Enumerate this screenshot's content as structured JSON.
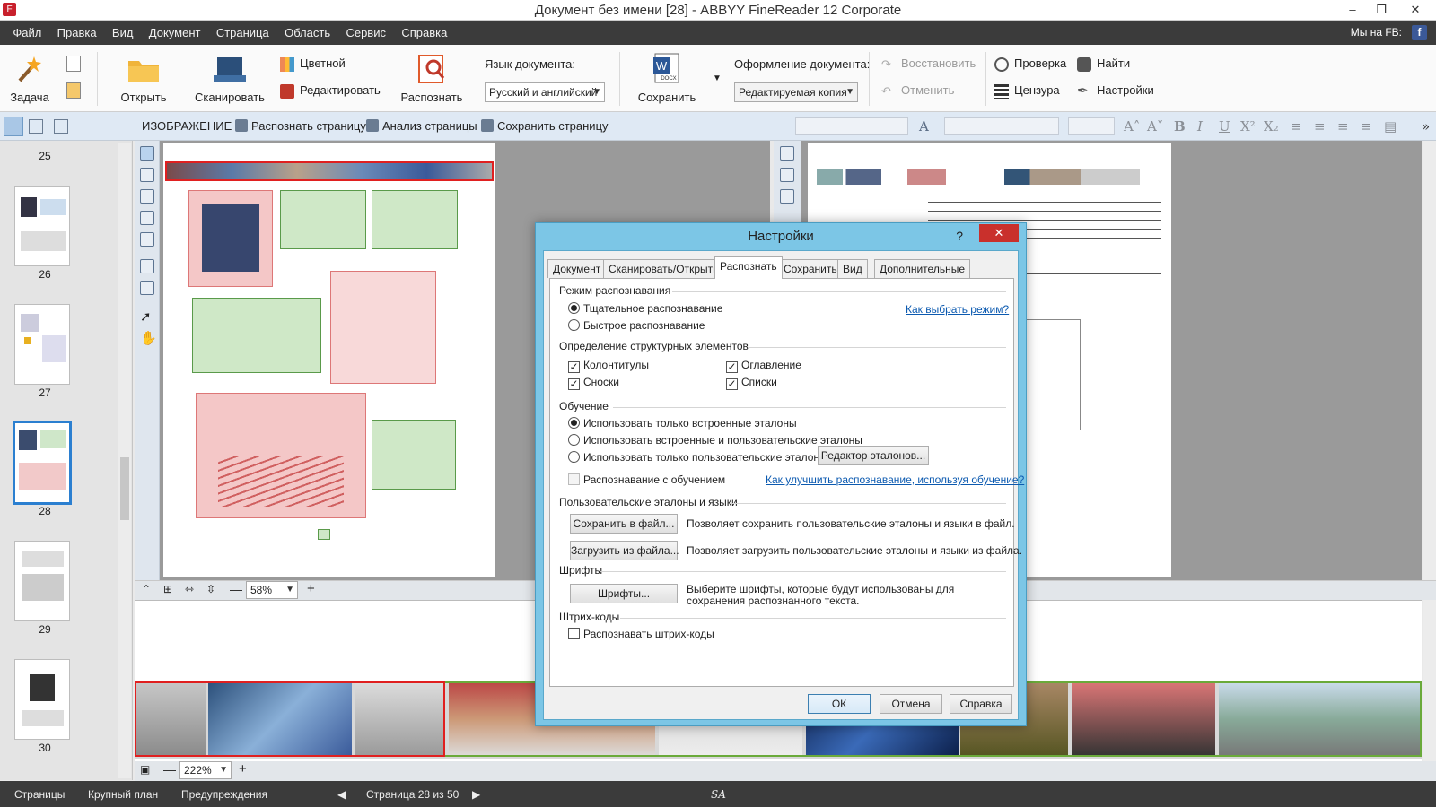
{
  "window": {
    "title": "Документ без имени [28] - ABBYY FineReader 12 Corporate",
    "app_icon": "F"
  },
  "menu": {
    "items": [
      "Файл",
      "Правка",
      "Вид",
      "Документ",
      "Страница",
      "Область",
      "Сервис",
      "Справка"
    ],
    "fb_label": "Мы на FB:",
    "fb_icon": "f"
  },
  "ribbon": {
    "task": "Задача",
    "open": "Открыть",
    "scan": "Сканировать",
    "color": "Цветной",
    "edit": "Редактировать",
    "recognize": "Распознать",
    "lang_label": "Язык документа:",
    "lang_value": "Русский и английский",
    "save": "Сохранить",
    "save_icon_text": "DOCX",
    "format_label": "Оформление документа:",
    "format_value": "Редактируемая копия",
    "restore": "Восстановить",
    "undo": "Отменить",
    "check": "Проверка",
    "find": "Найти",
    "censor": "Цензура",
    "settings": "Настройки"
  },
  "subbar": {
    "image_label": "ИЗОБРАЖЕНИЕ",
    "recognize_page": "Распознать страницу",
    "analyze_page": "Анализ страницы",
    "save_page": "Сохранить страницу"
  },
  "format_toolbar": {
    "bold": "B",
    "italic": "I",
    "underline": "U",
    "superscript": "X²",
    "subscript": "X₂",
    "grow": "A˄",
    "shrink": "A˅"
  },
  "thumbnails": {
    "pages": [
      "25",
      "26",
      "27",
      "28",
      "29",
      "30"
    ],
    "selected": "28"
  },
  "image_view": {
    "zoom": "58%"
  },
  "zoom_view": {
    "zoom": "222%"
  },
  "status": {
    "pages_tab": "Страницы",
    "zoom_tab": "Крупный план",
    "warnings_tab": "Предупреждения",
    "page_info": "Страница 28 из 50",
    "watermark": "SA"
  },
  "dialog": {
    "title": "Настройки",
    "help_glyph": "?",
    "close_glyph": "✕",
    "tabs": [
      "Документ",
      "Сканировать/Открыть",
      "Распознать",
      "Сохранить",
      "Вид",
      "Дополнительные"
    ],
    "active_tab": "Распознать",
    "mode": {
      "header": "Режим распознавания",
      "thorough": "Тщательное распознавание",
      "fast": "Быстрое распознавание",
      "help_link": "Как выбрать режим?"
    },
    "structure": {
      "header": "Определение структурных элементов",
      "headers_footers": "Колонтитулы",
      "toc": "Оглавление",
      "footnotes": "Сноски",
      "lists": "Списки"
    },
    "training": {
      "header": "Обучение",
      "builtin": "Использовать только встроенные эталоны",
      "builtin_user": "Использовать встроенные и пользовательские эталоны",
      "user_only": "Использовать только пользовательские эталоны",
      "editor_btn": "Редактор эталонов...",
      "with_training": "Распознавание с обучением",
      "improve_link": "Как улучшить распознавание, используя обучение?"
    },
    "user_patterns": {
      "header": "Пользовательские эталоны и языки",
      "save_btn": "Сохранить в файл...",
      "save_desc": "Позволяет сохранить пользовательские эталоны и языки в файл.",
      "load_btn": "Загрузить из файла...",
      "load_desc": "Позволяет загрузить пользовательские эталоны и языки из файла."
    },
    "fonts": {
      "header": "Шрифты",
      "btn": "Шрифты...",
      "desc": "Выберите шрифты, которые будут использованы для сохранения распознанного текста."
    },
    "barcodes": {
      "header": "Штрих-коды",
      "recognize": "Распознавать штрих-коды"
    },
    "ok": "ОК",
    "cancel": "Отмена",
    "help": "Справка"
  },
  "colors": {
    "accent": "#2b7fd0",
    "dialog_frame": "#7cc6e6",
    "menubar": "#3b3b3b",
    "close": "#c9302c",
    "link": "#0c5ab0"
  }
}
